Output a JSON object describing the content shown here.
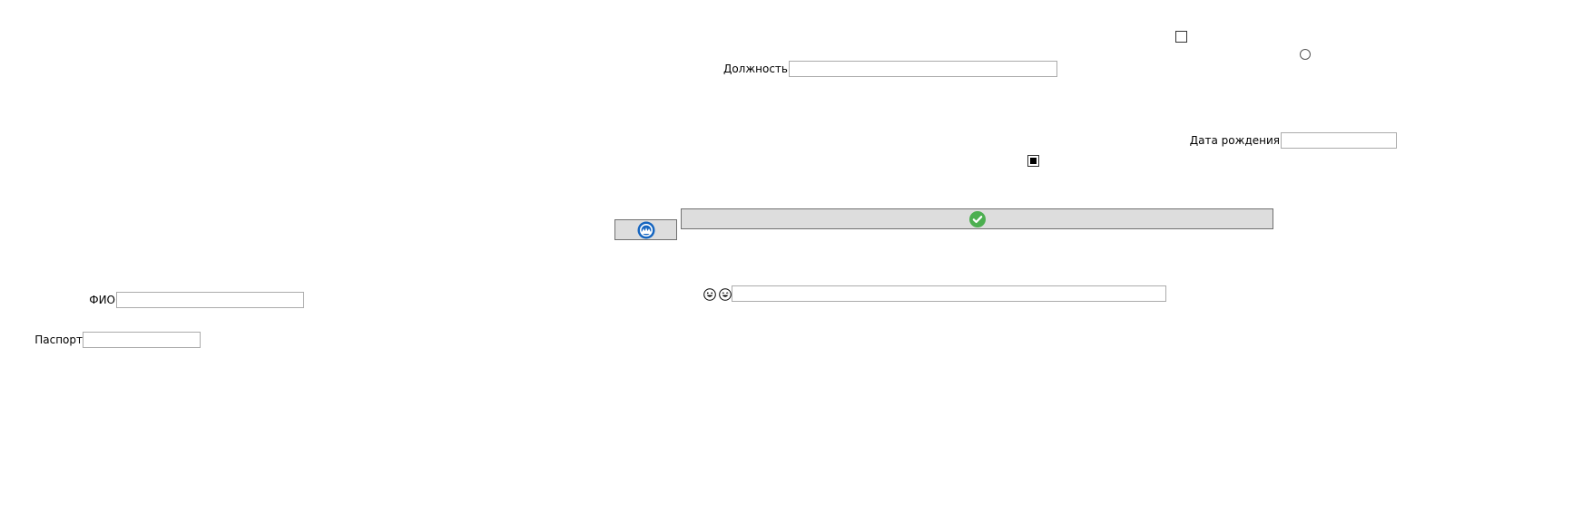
{
  "form": {
    "position_label": "Должность",
    "position_value": "",
    "birthdate_label": "Дата рождения",
    "birthdate_value": "",
    "fio_label": "ФИО",
    "fio_value": "",
    "passport_label": "Паспорт",
    "passport_value": "",
    "bottom_field_value": ""
  },
  "controls": {
    "checkbox_top_checked": false,
    "checkbox_middle_state": "indeterminate",
    "radio_selected": false
  },
  "icons": {
    "confirm_button_icon": "green-check-icon",
    "blue_button_icon": "blue-round-logo-icon",
    "emoji_1": "grinning-face-icon",
    "emoji_2": "grinning-face-icon"
  },
  "colors": {
    "button_background": "#dddddd",
    "check_green": "#4caf50",
    "logo_blue": "#1565c0",
    "input_border": "#ababab"
  }
}
